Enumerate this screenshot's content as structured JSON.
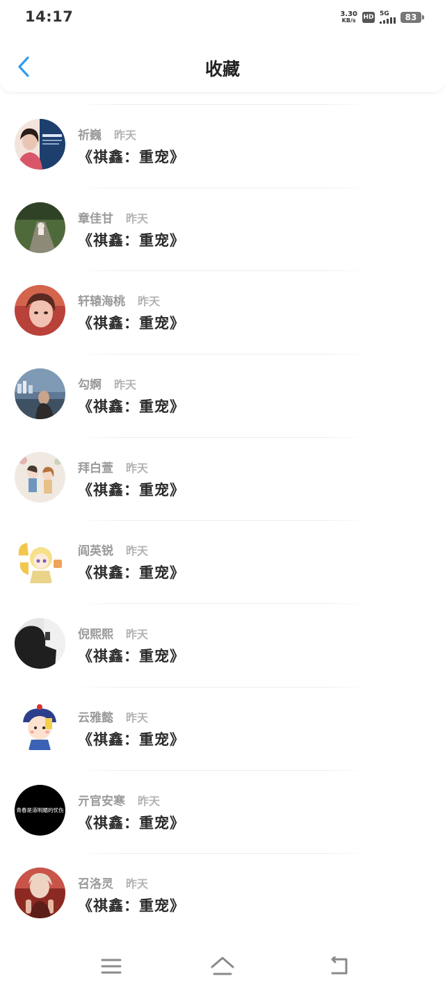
{
  "status_bar": {
    "time": "14:17",
    "net_speed_value": "3.30",
    "net_speed_unit": "KB/s",
    "hd_badge": "HD",
    "signal_label": "5G",
    "battery": "83"
  },
  "header": {
    "title": "收藏",
    "back_icon": "chevron-left-icon",
    "accent_color": "#2f9cf0"
  },
  "items": [
    {
      "name": "祈巍",
      "time": "昨天",
      "title": "《祺鑫：重宠》"
    },
    {
      "name": "章佳甘",
      "time": "昨天",
      "title": "《祺鑫：重宠》"
    },
    {
      "name": "轩辕海桃",
      "time": "昨天",
      "title": "《祺鑫：重宠》"
    },
    {
      "name": "勾婀",
      "time": "昨天",
      "title": "《祺鑫：重宠》"
    },
    {
      "name": "拜白萱",
      "time": "昨天",
      "title": "《祺鑫：重宠》"
    },
    {
      "name": "阎英锐",
      "time": "昨天",
      "title": "《祺鑫：重宠》"
    },
    {
      "name": "倪熙熙",
      "time": "昨天",
      "title": "《祺鑫：重宠》"
    },
    {
      "name": "云雅懿",
      "time": "昨天",
      "title": "《祺鑫：重宠》"
    },
    {
      "name": "亓官安寒",
      "time": "昨天",
      "title": "《祺鑫：重宠》",
      "avatar_text": "青春是道明媚的忧伤"
    },
    {
      "name": "召洛灵",
      "time": "昨天",
      "title": "《祺鑫：重宠》"
    }
  ],
  "bottom_nav": {
    "icons": [
      "menu-icon",
      "home-icon",
      "back-icon"
    ]
  }
}
